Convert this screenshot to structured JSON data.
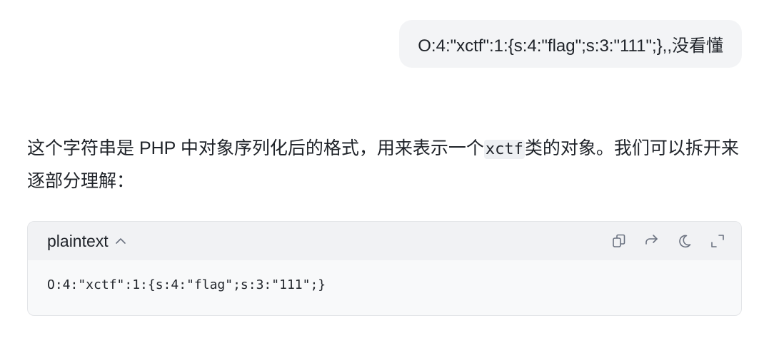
{
  "user_message": {
    "text": "O:4:\"xctf\":1:{s:4:\"flag\";s:3:\"111\";},,没看懂"
  },
  "answer": {
    "text_before_code": "这个字符串是 PHP 中对象序列化后的格式，用来表示一个",
    "inline_code": "xctf",
    "text_after_code": "类的对象。我们可以拆开来逐部分理解："
  },
  "code_block": {
    "language": "plaintext",
    "code": "O:4:\"xctf\":1:{s:4:\"flag\";s:3:\"111\";}",
    "toolbar_icons": [
      "copy-icon",
      "share-icon",
      "theme-toggle-icon",
      "expand-icon"
    ]
  },
  "colors": {
    "bubble_bg": "#f3f4f6",
    "code_header_bg": "#f1f2f4",
    "code_body_bg": "#f8f9fa",
    "icon_color": "#6b7280"
  }
}
